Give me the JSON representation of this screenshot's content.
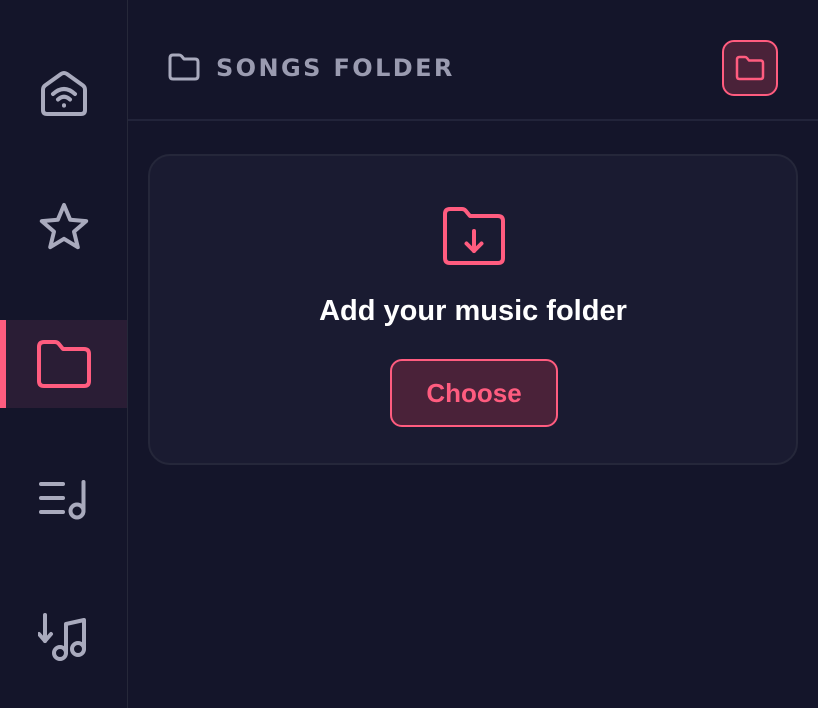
{
  "colors": {
    "background": "#14152a",
    "accent": "#ff5c7f",
    "icon_default": "#a9aabd",
    "card_background": "#1a1b31"
  },
  "sidebar": {
    "items": [
      {
        "icon": "home-wifi-icon",
        "active": false
      },
      {
        "icon": "star-icon",
        "active": false
      },
      {
        "icon": "folder-icon",
        "active": true
      },
      {
        "icon": "playlist-icon",
        "active": false
      },
      {
        "icon": "sort-music-icon",
        "active": false
      }
    ]
  },
  "header": {
    "icon": "folder-outline-icon",
    "title": "SONGS FOLDER",
    "action_icon": "folder-icon"
  },
  "empty_state": {
    "icon": "folder-download-icon",
    "title": "Add your music folder",
    "button_label": "Choose"
  }
}
